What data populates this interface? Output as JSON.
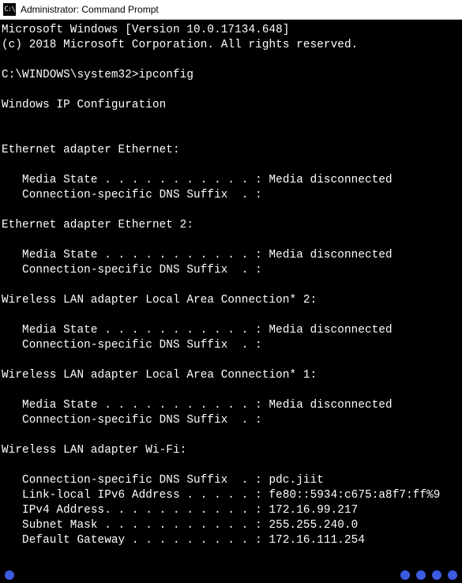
{
  "window": {
    "title": "Administrator: Command Prompt",
    "icon_text": "C:\\"
  },
  "terminal": {
    "banner1": "Microsoft Windows [Version 10.0.17134.648]",
    "banner2": "(c) 2018 Microsoft Corporation. All rights reserved.",
    "prompt": "C:\\WINDOWS\\system32>",
    "command": "ipconfig",
    "heading": "Windows IP Configuration",
    "adapters": [
      {
        "title": "Ethernet adapter Ethernet:",
        "lines": [
          "   Media State . . . . . . . . . . . : Media disconnected",
          "   Connection-specific DNS Suffix  . :"
        ]
      },
      {
        "title": "Ethernet adapter Ethernet 2:",
        "lines": [
          "   Media State . . . . . . . . . . . : Media disconnected",
          "   Connection-specific DNS Suffix  . :"
        ]
      },
      {
        "title": "Wireless LAN adapter Local Area Connection* 2:",
        "lines": [
          "   Media State . . . . . . . . . . . : Media disconnected",
          "   Connection-specific DNS Suffix  . :"
        ]
      },
      {
        "title": "Wireless LAN adapter Local Area Connection* 1:",
        "lines": [
          "   Media State . . . . . . . . . . . : Media disconnected",
          "   Connection-specific DNS Suffix  . :"
        ]
      },
      {
        "title": "Wireless LAN adapter Wi-Fi:",
        "lines": [
          "   Connection-specific DNS Suffix  . : pdc.jiit",
          "   Link-local IPv6 Address . . . . . : fe80::5934:c675:a8f7:ff%9",
          "   IPv4 Address. . . . . . . . . . . : 172.16.99.217",
          "   Subnet Mask . . . . . . . . . . . : 255.255.240.0",
          "   Default Gateway . . . . . . . . . : 172.16.111.254"
        ]
      }
    ]
  }
}
